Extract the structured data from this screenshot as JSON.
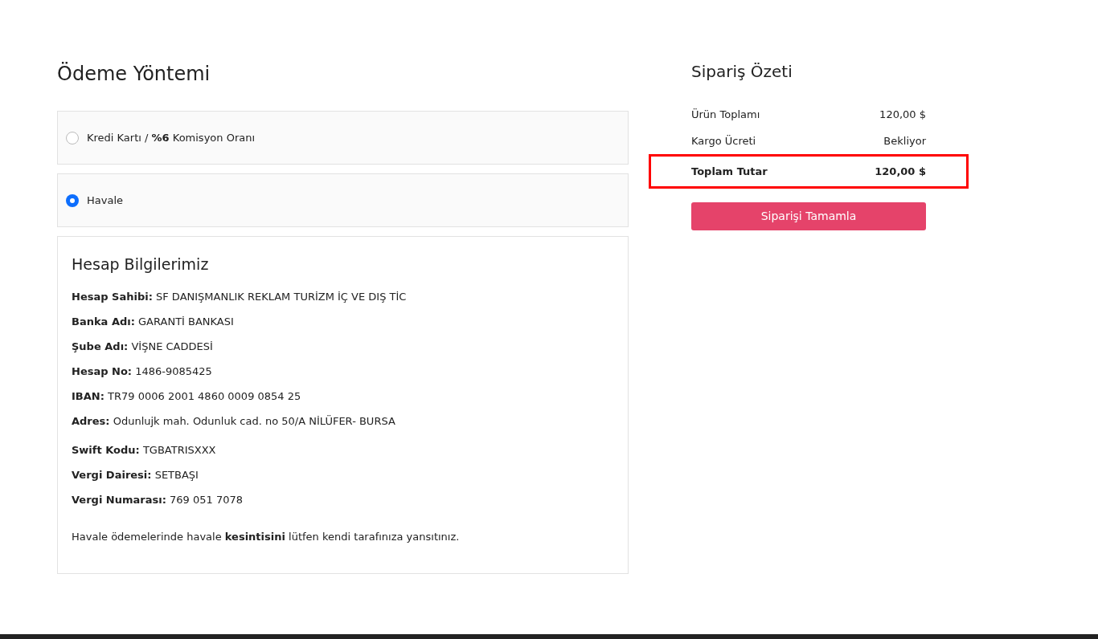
{
  "payment": {
    "title": "Ödeme Yöntemi",
    "options": [
      {
        "label": "Kredi Kartı / **%6** Komisyon Oranı",
        "selected": false
      },
      {
        "label": "Havale",
        "selected": true
      }
    ],
    "account_info": {
      "title": "Hesap Bilgilerimiz",
      "groups": [
        [
          "**Hesap Sahibi:** SF DANIŞMANLIK REKLAM TURİZM İÇ VE DIŞ TİC",
          "**Banka Adı:** GARANTİ BANKASI",
          "**Şube Adı:** VİŞNE CADDESİ",
          "**Hesap No:** 1486-9085425",
          "**IBAN:** TR79 0006 2001 4860 0009 0854 25",
          "**Adres:** Odunlujk mah. Odunluk cad. no 50/A NİLÜFER- BURSA"
        ],
        [
          "**Swift Kodu:** TGBATRISXXX",
          "**Vergi Dairesi:** SETBAŞI",
          "**Vergi Numarası:** 769 051 7078"
        ]
      ],
      "note": "Havale ödemelerinde havale **kesintisini** lütfen kendi tarafınıza yansıtınız."
    }
  },
  "summary": {
    "title": "Sipariş Özeti",
    "rows": [
      {
        "kind": "item",
        "label": "Ürün Toplamı",
        "value": "120,00 $",
        "highlighted": false
      },
      {
        "kind": "item",
        "label": "Kargo Ücreti",
        "value": "Bekliyor",
        "highlighted": false
      },
      {
        "kind": "total",
        "label": "Toplam Tutar",
        "value": "120,00 $",
        "highlighted": true
      }
    ],
    "button": "Siparişi Tamamla"
  }
}
